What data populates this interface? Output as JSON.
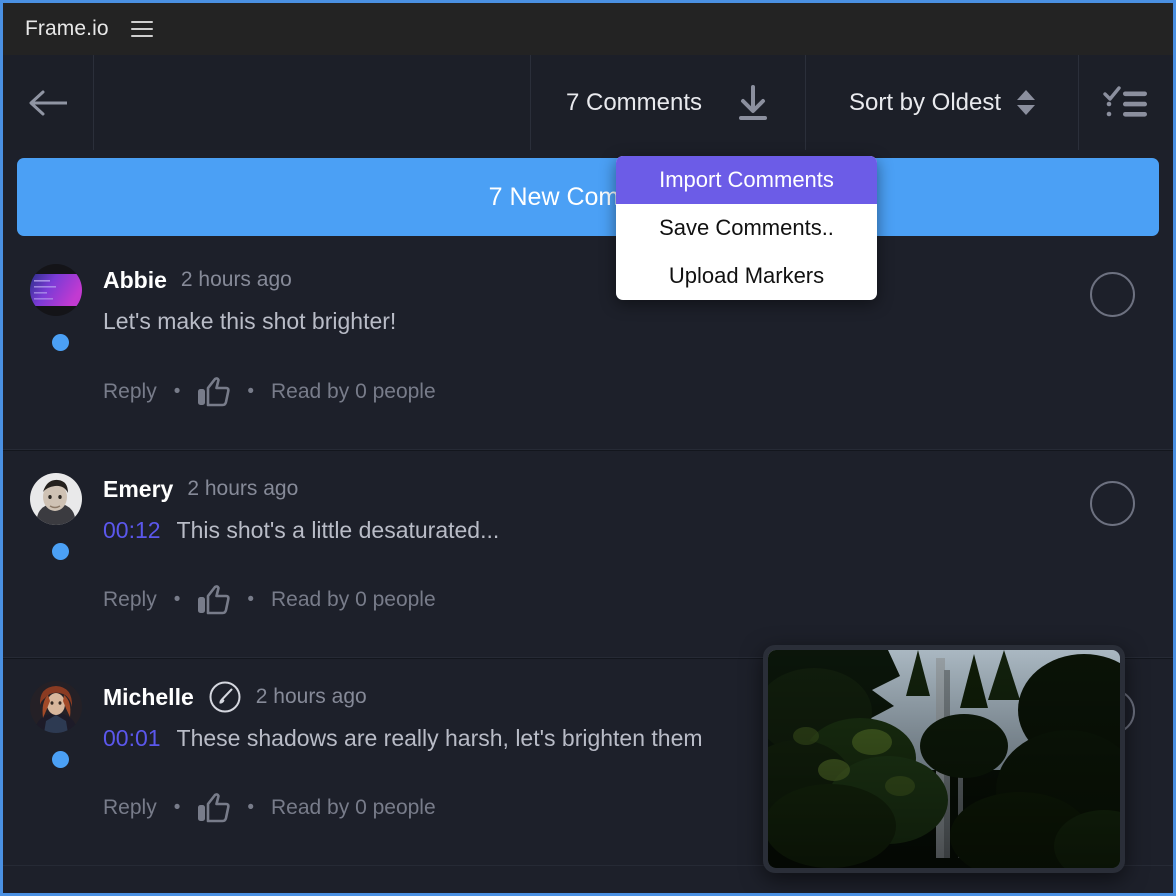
{
  "window": {
    "app_title": "Frame.io",
    "menu_icon": "hamburger-icon",
    "border_color": "#4a90e2"
  },
  "toolbar": {
    "back_icon": "back-arrow-icon",
    "comment_count_label": "7 Comments",
    "download_icon": "download-icon",
    "sort_label": "Sort by Oldest",
    "sort_stepper_icon": "stepper-up-down-icon",
    "checklist_icon": "checklist-icon"
  },
  "banner": {
    "label": "7 New Comments",
    "color": "#4ba0f5"
  },
  "dropdown": {
    "items": [
      {
        "label": "Import Comments",
        "highlighted": true
      },
      {
        "label": "Save Comments..",
        "highlighted": false
      },
      {
        "label": "Upload Markers",
        "highlighted": false
      }
    ],
    "highlight_color": "#6C5CE7"
  },
  "comments": [
    {
      "author": "Abbie",
      "time": "2 hours ago",
      "timestamp": "",
      "text": "Let's make this shot brighter!",
      "reply_label": "Reply",
      "read_label": "Read by 0 people",
      "like_icon": "thumbs-up-icon",
      "separator": "•",
      "has_annotation_badge": false,
      "avatar_type": "gradient"
    },
    {
      "author": "Emery",
      "time": "2 hours ago",
      "timestamp": "00:12",
      "text": "This shot's a little desaturated...",
      "reply_label": "Reply",
      "read_label": "Read by 0 people",
      "like_icon": "thumbs-up-icon",
      "separator": "•",
      "has_annotation_badge": false,
      "avatar_type": "photo-man"
    },
    {
      "author": "Michelle",
      "time": "2 hours ago",
      "timestamp": "00:01",
      "text": "These shadows are really harsh, let's brighten them",
      "reply_label": "Reply",
      "read_label": "Read by 0 people",
      "like_icon": "thumbs-up-icon",
      "separator": "•",
      "has_annotation_badge": true,
      "badge_icon": "annotation-brush-icon",
      "avatar_type": "photo-woman"
    }
  ],
  "thumbnail": {
    "name": "forest-preview-thumbnail",
    "description": "dark forest with tall tree trunks and sky"
  }
}
